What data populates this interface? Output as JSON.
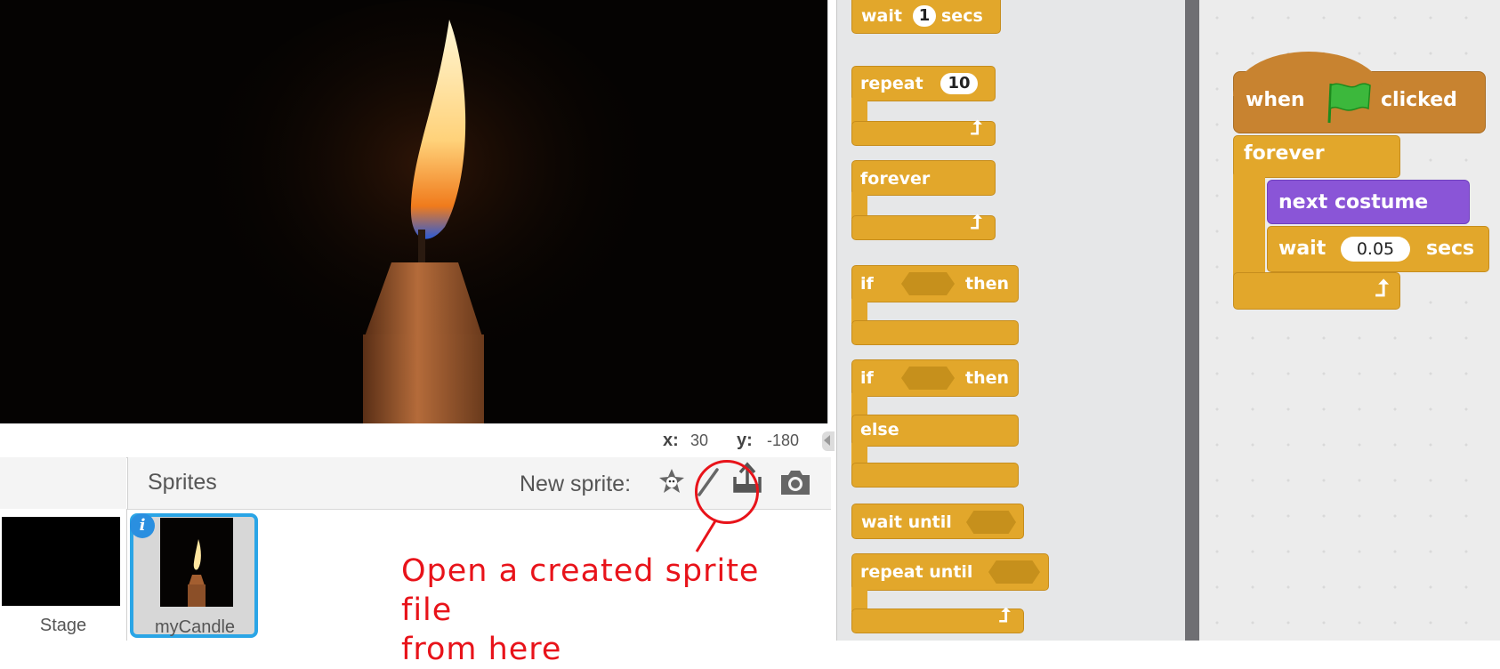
{
  "stage": {
    "coords": {
      "x_label": "x:",
      "x_value": "30",
      "y_label": "y:",
      "y_value": "-180"
    }
  },
  "sprites_pane": {
    "title": "Sprites",
    "new_sprite_label": "New sprite:",
    "tools": [
      "choose-from-library-icon",
      "paint-new-sprite-icon",
      "upload-sprite-icon",
      "camera-icon"
    ],
    "stage_label": "Stage",
    "sprite_name": "myCandle",
    "info_glyph": "i"
  },
  "annotation": {
    "text": "Open a created sprite file\nfrom here",
    "color": "#e8131a"
  },
  "palette": {
    "wait_block": {
      "label": "wait",
      "value": "1",
      "unit": "secs"
    },
    "repeat_block": {
      "label": "repeat",
      "value": "10"
    },
    "forever_block": {
      "label": "forever"
    },
    "if_then_block": {
      "if_label": "if",
      "then_label": "then"
    },
    "if_else_block": {
      "if_label": "if",
      "then_label": "then",
      "else_label": "else"
    },
    "wait_until_block": {
      "label": "wait until"
    },
    "repeat_until_block": {
      "label": "repeat until"
    }
  },
  "script": {
    "hat": {
      "when_label": "when",
      "clicked_label": "clicked"
    },
    "forever_label": "forever",
    "next_costume_label": "next costume",
    "wait": {
      "label": "wait",
      "value": "0.05",
      "unit": "secs"
    }
  },
  "colors": {
    "control_block": "#e2a72b",
    "events_block": "#c88330",
    "looks_block": "#8a55d7",
    "selection": "#2aa5e6",
    "annotation": "#e8131a"
  }
}
